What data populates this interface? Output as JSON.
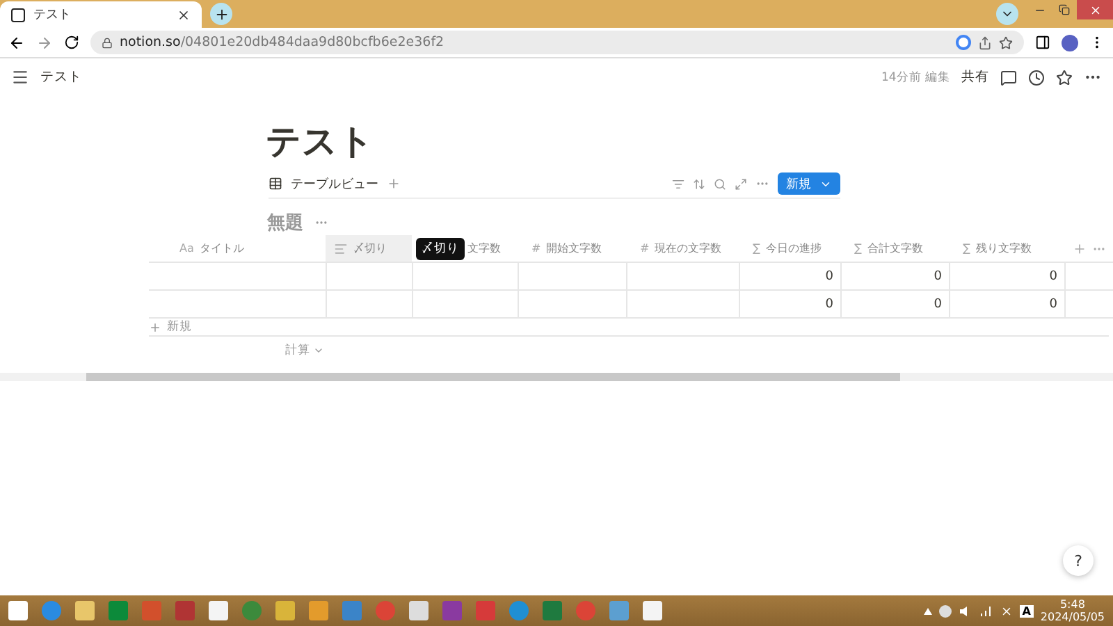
{
  "browser": {
    "tab_title": "テスト",
    "url_host": "notion.so",
    "url_path": "/04801e20db484daa9d80bcfb6e2e36f2"
  },
  "topbar": {
    "breadcrumb": "テスト",
    "edited": "14分前 編集",
    "share": "共有"
  },
  "page": {
    "title": "テスト",
    "view": "テーブルビュー",
    "new_button": "新規",
    "db_title": "無題"
  },
  "table": {
    "columns": [
      {
        "kind": "text",
        "icon": "Aa",
        "label": "タイトル",
        "selected": false
      },
      {
        "kind": "lines",
        "label": "〆切り",
        "selected": true
      },
      {
        "kind": "plain",
        "label": "文字数",
        "selected": false
      },
      {
        "kind": "text",
        "icon": "#",
        "label": "開始文字数",
        "selected": false
      },
      {
        "kind": "text",
        "icon": "#",
        "label": "現在の文字数",
        "selected": false
      },
      {
        "kind": "text",
        "icon": "∑",
        "label": "今日の進捗",
        "selected": false
      },
      {
        "kind": "text",
        "icon": "∑",
        "label": "合計文字数",
        "selected": false
      },
      {
        "kind": "text",
        "icon": "∑",
        "label": "残り文字数",
        "selected": false
      }
    ],
    "tooltip": "〆切り",
    "rows": [
      [
        "",
        "",
        "",
        "",
        "",
        "0",
        "0",
        "0"
      ],
      [
        "",
        "",
        "",
        "",
        "",
        "0",
        "0",
        "0"
      ]
    ],
    "add_row": "新規",
    "calc": "計算"
  },
  "help": "?",
  "taskbar": {
    "ime": "A",
    "time": "5:48",
    "date": "2024/05/05"
  }
}
